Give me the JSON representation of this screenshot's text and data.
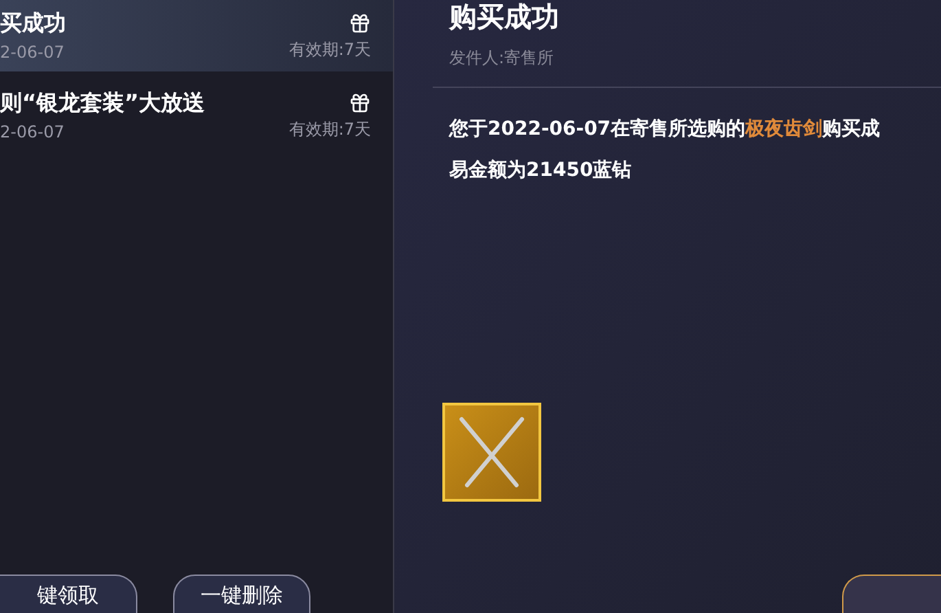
{
  "mail_list": [
    {
      "title": "买成功",
      "date": "2-06-07",
      "expiry": "有效期:7天",
      "selected": true
    },
    {
      "title": "则“银龙套装”大放送",
      "date": "2-06-07",
      "expiry": "有效期:7天",
      "selected": false
    }
  ],
  "list_buttons": [
    "键领取",
    "一键删除"
  ],
  "mail": {
    "title": "购买成功",
    "sender": "发件人:寄售所",
    "body": [
      [
        {
          "text": "您于2022-06-07在寄售所选购的",
          "highlight": false
        },
        {
          "text": "极夜齿剑",
          "highlight": true
        },
        {
          "text": "购买成",
          "highlight": false
        }
      ],
      [
        {
          "text": "易金额为21450蓝钻",
          "highlight": false
        }
      ]
    ]
  }
}
